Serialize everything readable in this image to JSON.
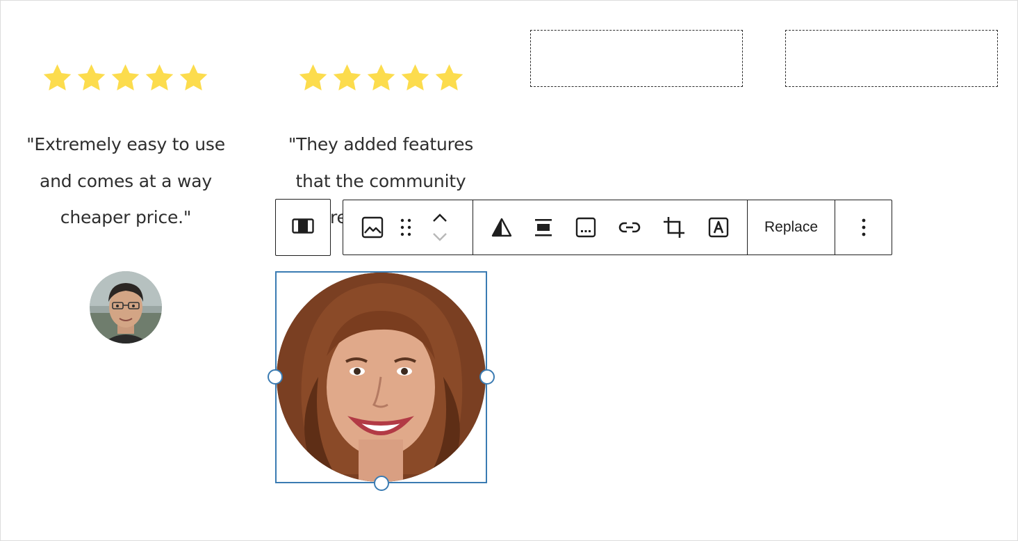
{
  "testimonials": [
    {
      "rating": 5,
      "quote_lines": [
        "\"Extremely easy to use",
        "and comes at a way",
        "cheaper price.\""
      ]
    },
    {
      "rating": 5,
      "quote_lines": [
        "\"They added features",
        "that the community",
        "re"
      ]
    }
  ],
  "toolbar": {
    "parent_icon": "parent-block-icon",
    "image_icon": "image-icon",
    "drag_icon": "drag-handle-icon",
    "move_up_icon": "chevron-up-icon",
    "move_down_icon": "chevron-down-icon",
    "duotone_icon": "duotone-icon",
    "align_icon": "align-center-icon",
    "caption_icon": "caption-icon",
    "link_icon": "link-icon",
    "crop_icon": "crop-icon",
    "text_overlay_icon": "text-overlay-icon",
    "replace_label": "Replace",
    "options_icon": "more-vertical-icon"
  },
  "colors": {
    "star": "#fcdc4d",
    "selection": "#3a7bb2",
    "toolbar_border": "#1e1e1e",
    "text": "#2e2e2e"
  }
}
